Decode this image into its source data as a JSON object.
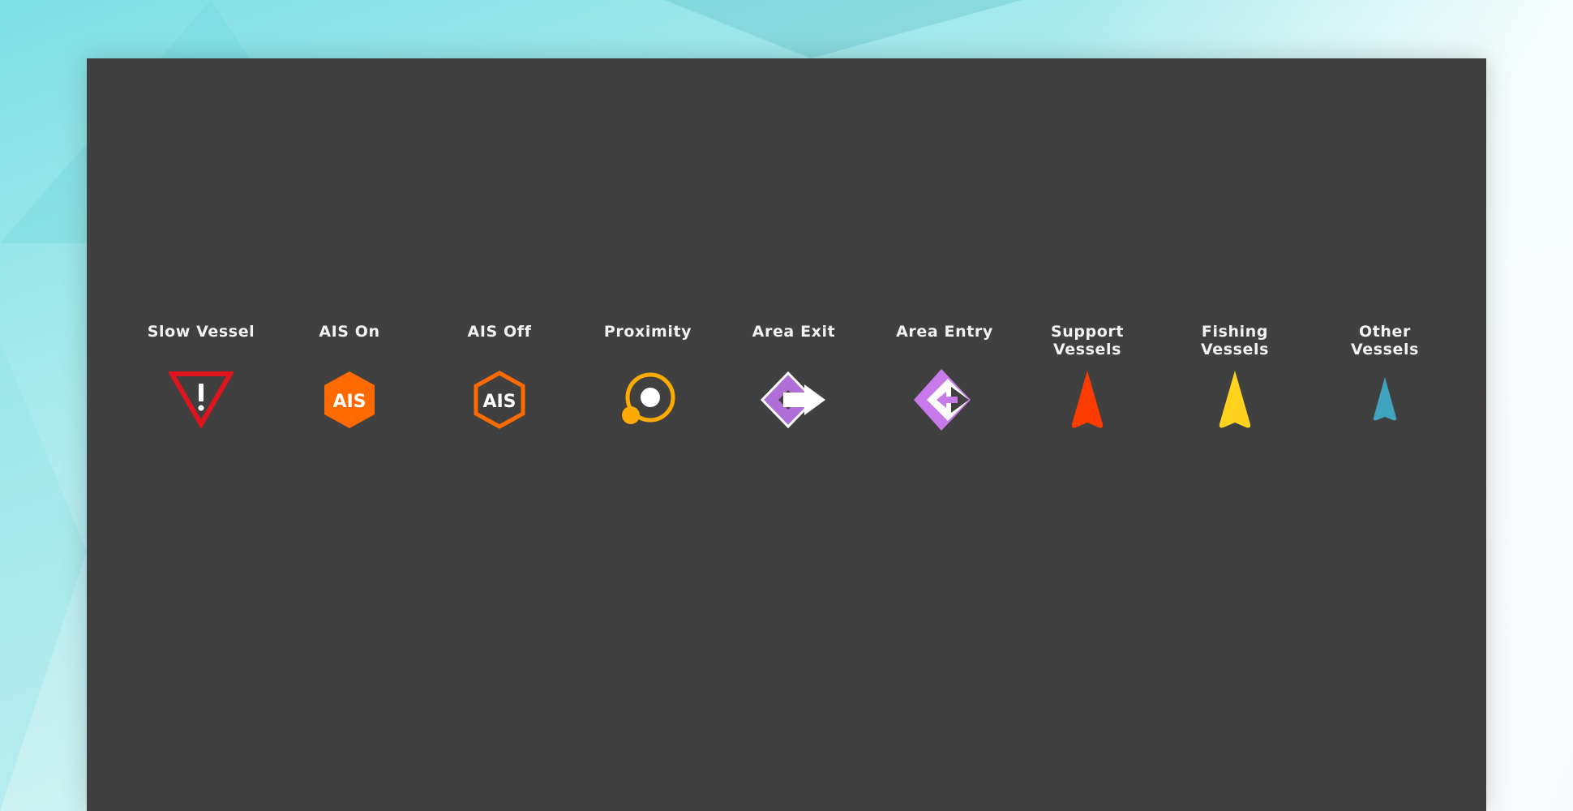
{
  "legend": {
    "items": [
      {
        "label": "Slow Vessel",
        "icon": "slow-vessel-warning-icon",
        "color": "#e0141e"
      },
      {
        "label": "AIS On",
        "icon": "ais-on-icon",
        "color": "#ff6a00",
        "icon_text": "AIS"
      },
      {
        "label": "AIS Off",
        "icon": "ais-off-icon",
        "color": "#ff6a00",
        "icon_text": "AIS"
      },
      {
        "label": "Proximity",
        "icon": "proximity-icon",
        "color": "#ffaa00"
      },
      {
        "label": "Area Exit",
        "icon": "area-exit-icon",
        "color": "#b06fd6"
      },
      {
        "label": "Area Entry",
        "icon": "area-entry-icon",
        "color": "#c87aea"
      },
      {
        "label": "Support\nVessels",
        "icon": "support-vessel-icon",
        "color": "#ff3c00"
      },
      {
        "label": "Fishing\nVessels",
        "icon": "fishing-vessel-icon",
        "color": "#ffd21e"
      },
      {
        "label": "Other\nVessels",
        "icon": "other-vessel-icon",
        "color": "#3ea4c0"
      }
    ]
  }
}
